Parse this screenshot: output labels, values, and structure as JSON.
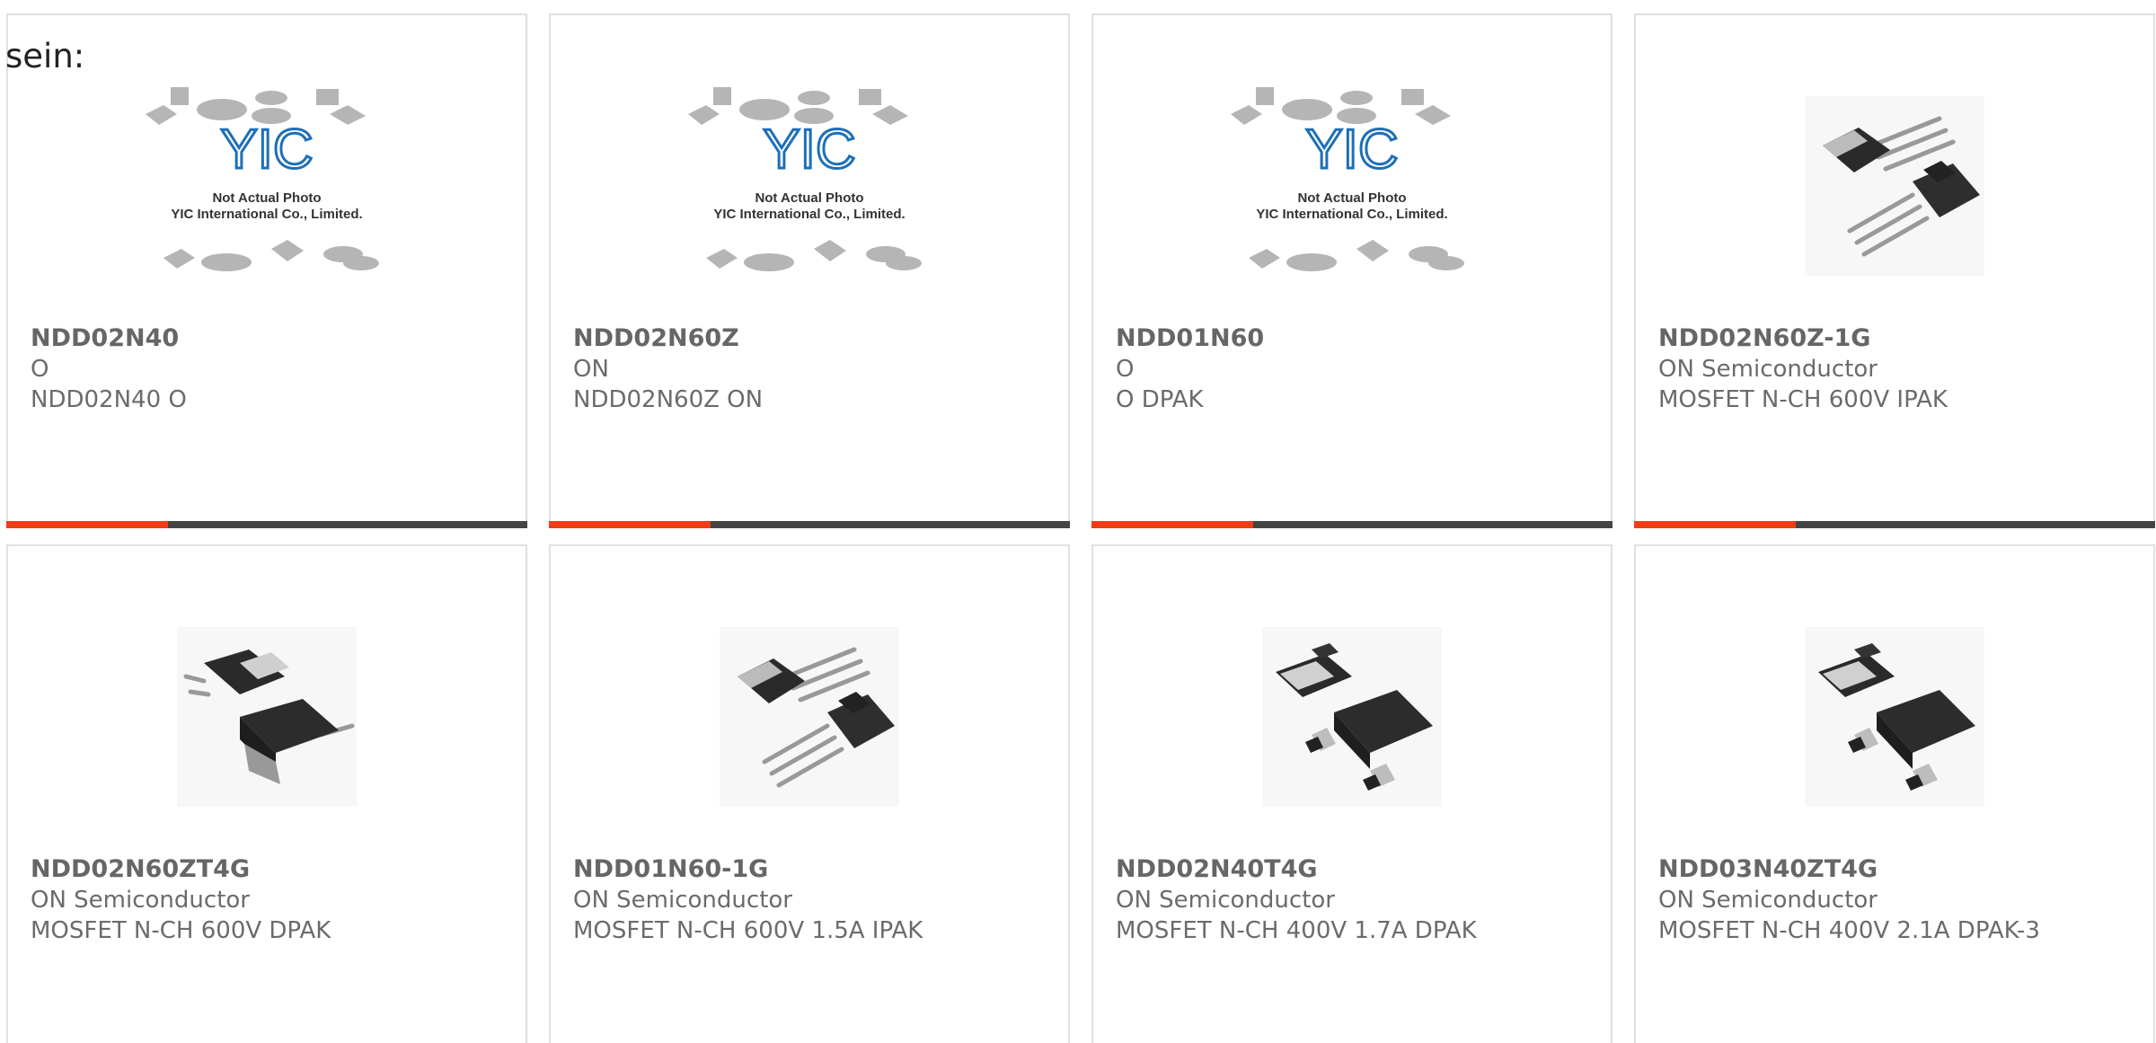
{
  "heading_partial": "sein:",
  "colors": {
    "accent": "#f23c16",
    "bar_track": "#444444",
    "card_border": "#e0e0e0",
    "text": "#6b6b6b",
    "logo_blue": "#1d6fb8"
  },
  "placeholder": {
    "line1": "Not Actual Photo",
    "line2": "YIC International Co., Limited.",
    "logo_text": "YIC"
  },
  "cards": [
    {
      "part_number": "NDD02N40",
      "manufacturer": "O",
      "description": "NDD02N40 O",
      "image": "placeholder-photo",
      "progress": 0.31
    },
    {
      "part_number": "NDD02N60Z",
      "manufacturer": "ON",
      "description": "NDD02N60Z ON",
      "image": "placeholder-photo",
      "progress": 0.31
    },
    {
      "part_number": "NDD01N60",
      "manufacturer": "O",
      "description": "O DPAK",
      "image": "placeholder-photo",
      "progress": 0.31
    },
    {
      "part_number": "NDD02N60Z-1G",
      "manufacturer": "ON Semiconductor",
      "description": "MOSFET N-CH 600V IPAK",
      "image": "ipak-package-icon",
      "progress": 0.31
    },
    {
      "part_number": "NDD02N60ZT4G",
      "manufacturer": "ON Semiconductor",
      "description": "MOSFET N-CH 600V DPAK",
      "image": "dpak-package-icon"
    },
    {
      "part_number": "NDD01N60-1G",
      "manufacturer": "ON Semiconductor",
      "description": "MOSFET N-CH 600V 1.5A IPAK",
      "image": "ipak-package-icon"
    },
    {
      "part_number": "NDD02N40T4G",
      "manufacturer": "ON Semiconductor",
      "description": "MOSFET N-CH 400V 1.7A DPAK",
      "image": "dpak-package-icon"
    },
    {
      "part_number": "NDD03N40ZT4G",
      "manufacturer": "ON Semiconductor",
      "description": "MOSFET N-CH 400V 2.1A DPAK-3",
      "image": "dpak-package-icon"
    }
  ]
}
